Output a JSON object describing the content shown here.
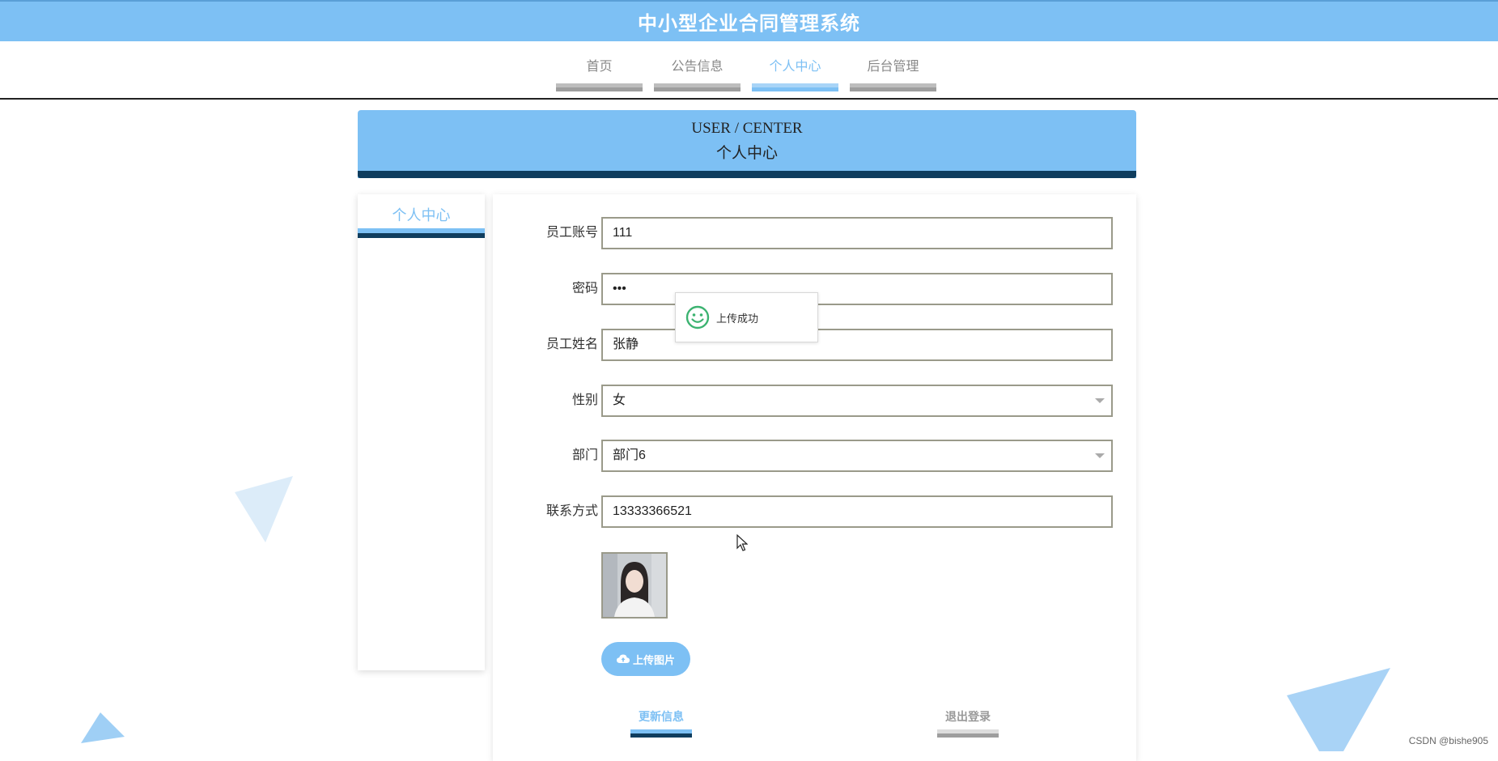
{
  "header": {
    "title": "中小型企业合同管理系统"
  },
  "nav": {
    "items": [
      {
        "label": "首页"
      },
      {
        "label": "公告信息"
      },
      {
        "label": "个人中心"
      },
      {
        "label": "后台管理"
      }
    ],
    "active": "个人中心"
  },
  "banner": {
    "en": "USER / CENTER",
    "cn": "个人中心"
  },
  "sidebar": {
    "label": "个人中心"
  },
  "form": {
    "account_label": "员工账号",
    "account_value": "111",
    "password_label": "密码",
    "password_value": "•••",
    "name_label": "员工姓名",
    "name_value": "张静",
    "gender_label": "性别",
    "gender_value": "女",
    "dept_label": "部门",
    "dept_value": "部门6",
    "phone_label": "联系方式",
    "phone_value": "13333366521"
  },
  "upload": {
    "label": "上传图片"
  },
  "actions": {
    "update_label": "更新信息",
    "logout_label": "退出登录"
  },
  "toast": {
    "message": "上传成功"
  },
  "watermark": "CSDN @bishe905",
  "colors": {
    "primary": "#7dc0f4",
    "dark": "#0f3d5e",
    "success": "#3cb371"
  }
}
